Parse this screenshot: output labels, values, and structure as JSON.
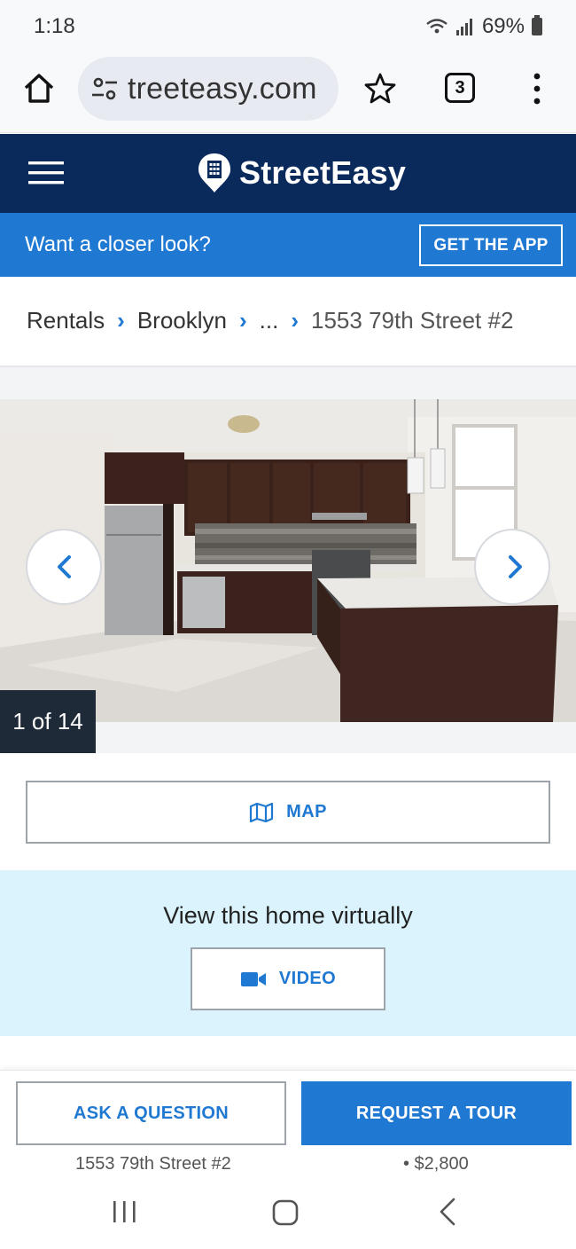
{
  "status_bar": {
    "time": "1:18",
    "battery": "69%"
  },
  "browser": {
    "url": "treeteasy.com",
    "tab_count": "3"
  },
  "header": {
    "logo_text": "StreetEasy",
    "brand_color": "#0b2a5c"
  },
  "app_banner": {
    "text": "Want a closer look?",
    "button": "GET THE APP"
  },
  "breadcrumb": {
    "items": [
      "Rentals",
      "Brooklyn",
      "...",
      "1553 79th Street #2"
    ]
  },
  "gallery": {
    "counter": "1 of 14"
  },
  "map": {
    "label": "MAP"
  },
  "virtual": {
    "title": "View this home virtually",
    "video_label": "VIDEO"
  },
  "actions": {
    "ask": "ASK A QUESTION",
    "tour": "REQUEST A TOUR",
    "address": "1553 79th Street #2",
    "price": "• $2,800"
  },
  "colors": {
    "accent": "#1f78d1",
    "virtual_bg": "#dbf3fd"
  }
}
